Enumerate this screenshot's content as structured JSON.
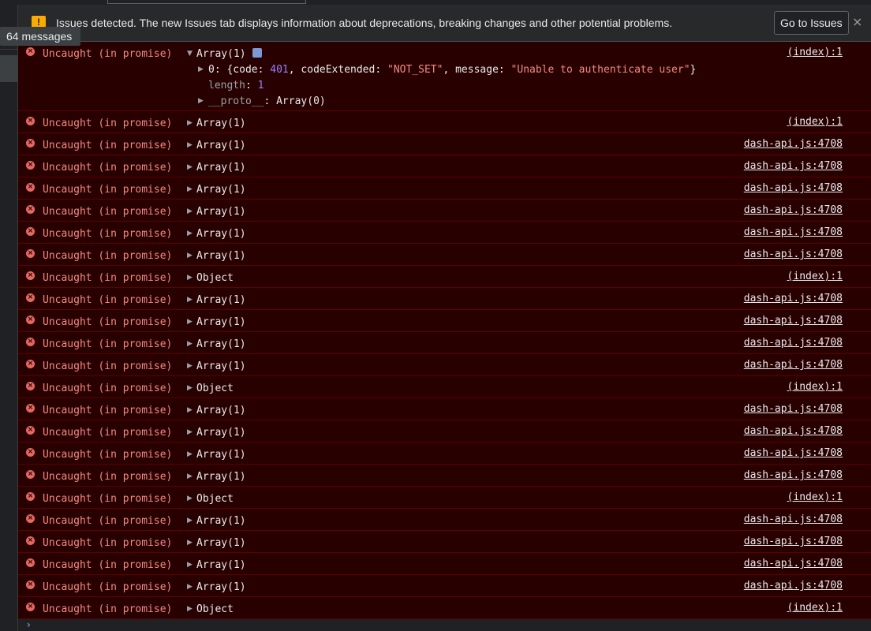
{
  "issues_bar": {
    "text": "Issues detected. The new Issues tab displays information about deprecations, breaking changes and other potential problems.",
    "button_label": "Go to Issues",
    "close_glyph": "×",
    "warn_glyph": "!"
  },
  "tooltip": "64 messages",
  "expanded": {
    "line_0_prefix": "0: {code: ",
    "line_0_code": "401",
    "line_0_mid": ", codeExtended: ",
    "line_0_ext": "\"NOT_SET\"",
    "line_0_mid2": ", message: ",
    "line_0_msg": "\"Unable to authenticate user\"",
    "line_0_end": "}",
    "length_key": "length",
    "length_value": "1",
    "proto_key": "__proto__",
    "proto_value": ": Array(0)",
    "colon": ": "
  },
  "messages": [
    {
      "text": "Uncaught (in promise)",
      "object": "Array(1)",
      "source": "(index):1",
      "expanded": true
    },
    {
      "text": "Uncaught (in promise)",
      "object": "Array(1)",
      "source": "(index):1"
    },
    {
      "text": "Uncaught (in promise)",
      "object": "Array(1)",
      "source": "dash-api.js:4708"
    },
    {
      "text": "Uncaught (in promise)",
      "object": "Array(1)",
      "source": "dash-api.js:4708"
    },
    {
      "text": "Uncaught (in promise)",
      "object": "Array(1)",
      "source": "dash-api.js:4708"
    },
    {
      "text": "Uncaught (in promise)",
      "object": "Array(1)",
      "source": "dash-api.js:4708"
    },
    {
      "text": "Uncaught (in promise)",
      "object": "Array(1)",
      "source": "dash-api.js:4708"
    },
    {
      "text": "Uncaught (in promise)",
      "object": "Array(1)",
      "source": "dash-api.js:4708"
    },
    {
      "text": "Uncaught (in promise)",
      "object": "Object",
      "source": "(index):1"
    },
    {
      "text": "Uncaught (in promise)",
      "object": "Array(1)",
      "source": "dash-api.js:4708"
    },
    {
      "text": "Uncaught (in promise)",
      "object": "Array(1)",
      "source": "dash-api.js:4708"
    },
    {
      "text": "Uncaught (in promise)",
      "object": "Array(1)",
      "source": "dash-api.js:4708"
    },
    {
      "text": "Uncaught (in promise)",
      "object": "Array(1)",
      "source": "dash-api.js:4708"
    },
    {
      "text": "Uncaught (in promise)",
      "object": "Object",
      "source": "(index):1"
    },
    {
      "text": "Uncaught (in promise)",
      "object": "Array(1)",
      "source": "dash-api.js:4708"
    },
    {
      "text": "Uncaught (in promise)",
      "object": "Array(1)",
      "source": "dash-api.js:4708"
    },
    {
      "text": "Uncaught (in promise)",
      "object": "Array(1)",
      "source": "dash-api.js:4708"
    },
    {
      "text": "Uncaught (in promise)",
      "object": "Array(1)",
      "source": "dash-api.js:4708"
    },
    {
      "text": "Uncaught (in promise)",
      "object": "Object",
      "source": "(index):1"
    },
    {
      "text": "Uncaught (in promise)",
      "object": "Array(1)",
      "source": "dash-api.js:4708"
    },
    {
      "text": "Uncaught (in promise)",
      "object": "Array(1)",
      "source": "dash-api.js:4708"
    },
    {
      "text": "Uncaught (in promise)",
      "object": "Array(1)",
      "source": "dash-api.js:4708"
    },
    {
      "text": "Uncaught (in promise)",
      "object": "Array(1)",
      "source": "dash-api.js:4708"
    },
    {
      "text": "Uncaught (in promise)",
      "object": "Object",
      "source": "(index):1"
    }
  ],
  "glyphs": {
    "error": "×",
    "collapsed": "▶",
    "expanded": "▼",
    "prompt": "›"
  },
  "colors": {
    "error_background": "#290000",
    "error_border": "#5c0000",
    "error_text": "#f28b82",
    "warning": "#f9ab00",
    "number": "#9980ff",
    "accent": "#8ab4f8"
  }
}
